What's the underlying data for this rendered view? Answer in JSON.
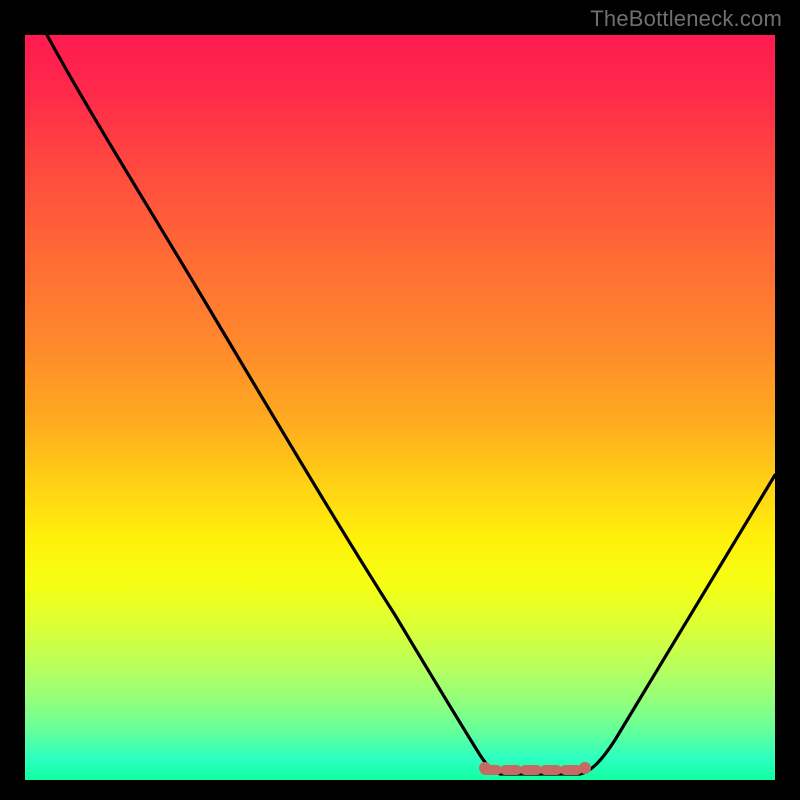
{
  "watermark": "TheBottleneck.com",
  "chart_data": {
    "type": "line",
    "title": "",
    "xlabel": "",
    "ylabel": "",
    "xlim": [
      0,
      100
    ],
    "ylim": [
      0,
      100
    ],
    "series": [
      {
        "name": "bottleneck-curve",
        "x": [
          3,
          10,
          20,
          30,
          40,
          50,
          55,
          58,
          62,
          66,
          70,
          73,
          76,
          82,
          90,
          100
        ],
        "y": [
          100,
          88,
          72,
          56,
          40,
          24,
          16,
          8,
          2,
          0,
          0,
          0,
          2,
          10,
          24,
          42
        ]
      }
    ],
    "annotations": [
      {
        "name": "flat-minimum-band",
        "x_range": [
          62,
          76
        ],
        "y": 1,
        "color": "#c66a63"
      }
    ]
  },
  "colors": {
    "curve": "#000000",
    "band": "#c66a63",
    "background_top": "#ff1a50",
    "background_bottom": "#10ff9f",
    "frame": "#000000",
    "watermark": "#6f6f6f"
  }
}
